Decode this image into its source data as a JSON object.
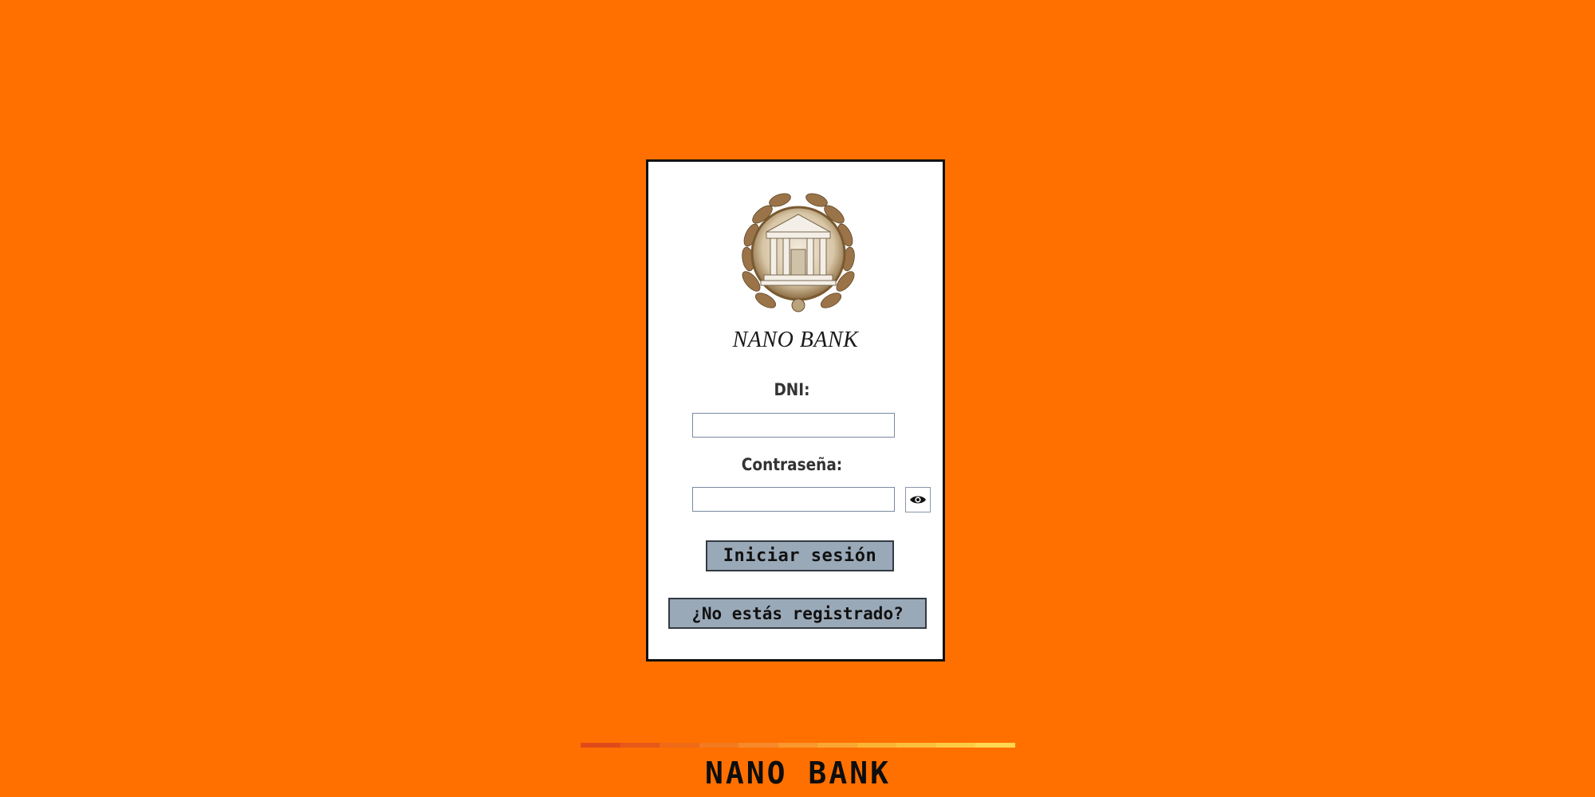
{
  "colors": {
    "background": "#ff7000",
    "card": "#ffffff",
    "button": "#9aa9b8",
    "footer_gradient": [
      "#e04a1a",
      "#e8581a",
      "#ef6a18",
      "#f47a20",
      "#f6892a",
      "#f8982e",
      "#f9a632",
      "#fab436",
      "#fbc03c",
      "#fccc44",
      "#fdd850"
    ]
  },
  "login": {
    "brand": "NANO BANK",
    "logo_icon": "bank-temple-laurel-emblem",
    "dni_label": "DNI:",
    "dni_value": "",
    "password_label": "Contraseña:",
    "password_value": "",
    "show_password_icon": "eye-icon",
    "login_button": "Iniciar sesión",
    "register_button": "¿No estás registrado?"
  },
  "footer": {
    "title": "NANO BANK"
  }
}
